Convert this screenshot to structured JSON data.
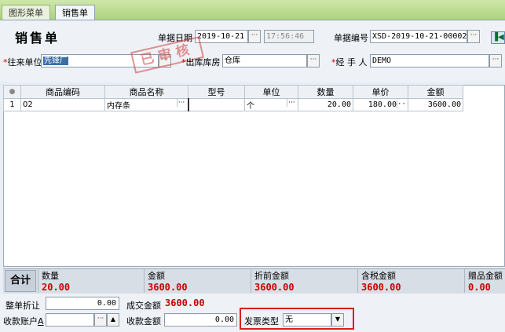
{
  "tabs": [
    {
      "label": "图形菜单",
      "active": false
    },
    {
      "label": "销售单",
      "active": true
    }
  ],
  "header": {
    "title": "销售单",
    "date_label": "单据日期",
    "date_value": "2019-10-21",
    "time_value": "17:56:46",
    "docno_label": "单据编号",
    "docno_value": "XSD-2019-10-21-00002",
    "partner_label": "往来单位",
    "partner_value": "先锋厂",
    "warehouse_label": "出库库房",
    "warehouse_value": "仓库",
    "handler_label": "经 手 人",
    "handler_value": "DEMO",
    "required_mark": "*",
    "dots": "···",
    "nav_icon": "first-record-icon"
  },
  "stamp_text": "已审核",
  "grid": {
    "columns": [
      "●",
      "商品编码",
      "商品名称",
      "型号",
      "单位",
      "数量",
      "单价",
      "金额"
    ],
    "rows": [
      {
        "idx": "1",
        "code": "02",
        "name": "内存条",
        "model": "",
        "unit": "个",
        "qty": "20.00",
        "price": "180.00",
        "amount": "3600.00"
      }
    ]
  },
  "totals": {
    "sum_label": "合计",
    "items": [
      {
        "label": "数量",
        "value": "20.00"
      },
      {
        "label": "金额",
        "value": "3600.00"
      },
      {
        "label": "折前金额",
        "value": "3600.00"
      },
      {
        "label": "含税金额",
        "value": "3600.00"
      },
      {
        "label": "赠品金额",
        "value": "0.00"
      }
    ]
  },
  "footer": {
    "discount_label": "整单折让",
    "discount_value": "0.00",
    "deal_label": "成交金额",
    "deal_value": "3600.00",
    "account_label": "收款账户",
    "account_underline": "A",
    "account_value": "",
    "receive_label": "收款金额",
    "receive_value": "0.00",
    "invoice_label": "发票类型",
    "invoice_value": "无"
  },
  "colors": {
    "accent_red": "#c80000",
    "highlight_border": "#d91f1f",
    "stamp": "#d23c3c",
    "tab_green": "#a8d37a"
  }
}
